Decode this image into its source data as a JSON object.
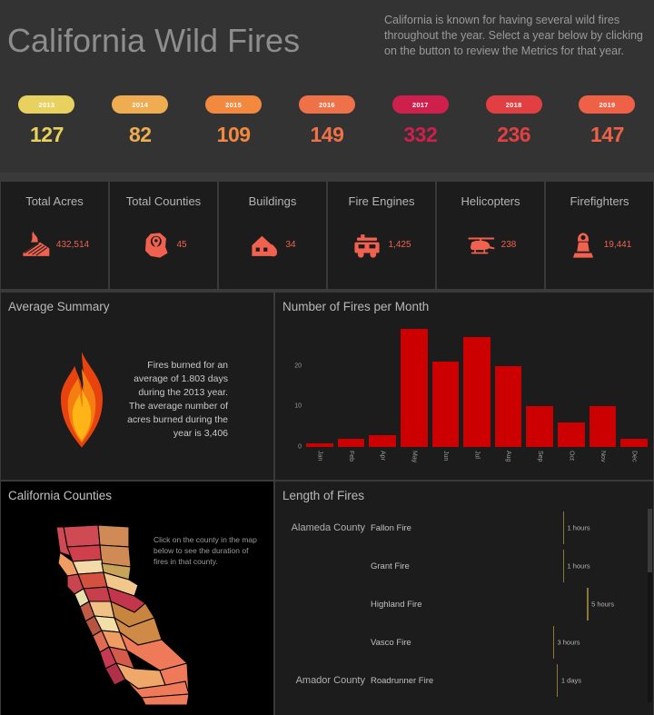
{
  "header": {
    "title": "California Wild Fires",
    "intro": "California is known for having several wild fires throughout the year. Select a year below by clicking on the button to review the Metrics for that year."
  },
  "year_selector": {
    "items": [
      {
        "year": "2013",
        "count": "127",
        "pill_color": "#e8d15e",
        "count_color": "#e8d15e"
      },
      {
        "year": "2014",
        "count": "82",
        "pill_color": "#f0ac50",
        "count_color": "#f0ac50"
      },
      {
        "year": "2015",
        "count": "109",
        "pill_color": "#f2893f",
        "count_color": "#f2893f"
      },
      {
        "year": "2016",
        "count": "149",
        "pill_color": "#ef7148",
        "count_color": "#ef7148"
      },
      {
        "year": "2017",
        "count": "332",
        "pill_color": "#cf1f4d",
        "count_color": "#cf1f4d"
      },
      {
        "year": "2018",
        "count": "236",
        "pill_color": "#e23f43",
        "count_color": "#e23f43"
      },
      {
        "year": "2019",
        "count": "147",
        "pill_color": "#ef6146",
        "count_color": "#ef6146"
      }
    ]
  },
  "kpis": [
    {
      "title": "Total Acres",
      "value": "432,514",
      "icon": "field-fire-icon"
    },
    {
      "title": "Total Counties",
      "value": "45",
      "icon": "map-pin-county-icon"
    },
    {
      "title": "Buildings",
      "value": "34",
      "icon": "house-fire-icon"
    },
    {
      "title": "Fire Engines",
      "value": "1,425",
      "icon": "fire-engine-icon"
    },
    {
      "title": "Helicopters",
      "value": "238",
      "icon": "helicopter-icon"
    },
    {
      "title": "Firefighters",
      "value": "19,441",
      "icon": "firefighter-icon"
    }
  ],
  "average_summary": {
    "title": "Average Summary",
    "text": "Fires burned for an average of 1.803 days during the 2013 year. The average number of acres burned during the year is 3,406",
    "icon": "flame-icon"
  },
  "fires_per_month": {
    "title": "Number of Fires per Month"
  },
  "counties_map": {
    "title": "California Counties",
    "hint": "Click on the county in the map below to see the duration of fires in that county."
  },
  "length_of_fires": {
    "title": "Length of Fires",
    "rows": [
      {
        "county": "Alameda County",
        "fire": "Fallon Fire",
        "duration": "1 hours",
        "mark_pct": 55
      },
      {
        "county": "",
        "fire": "Grant Fire",
        "duration": "1 hours",
        "mark_pct": 55
      },
      {
        "county": "",
        "fire": "Highland Fire",
        "duration": "5 hours",
        "mark_pct": 67
      },
      {
        "county": "",
        "fire": "Vasco Fire",
        "duration": "3 hours",
        "mark_pct": 50
      },
      {
        "county": "Amador County",
        "fire": "Roadrunner Fire",
        "duration": "1 days",
        "mark_pct": 52
      }
    ]
  },
  "chart_data": {
    "type": "bar",
    "title": "Number of Fires per Month",
    "categories": [
      "Jan",
      "Feb",
      "Apr",
      "May",
      "Jun",
      "Jul",
      "Aug",
      "Sep",
      "Oct",
      "Nov",
      "Dec"
    ],
    "values": [
      1,
      2,
      3,
      29,
      21,
      27,
      20,
      10,
      6,
      10,
      2
    ],
    "xlabel": "",
    "ylabel": "",
    "ylim": [
      0,
      30
    ],
    "yticks": [
      0,
      10,
      20
    ],
    "grid": false,
    "legend": "none",
    "bar_color": "#cc0000"
  }
}
